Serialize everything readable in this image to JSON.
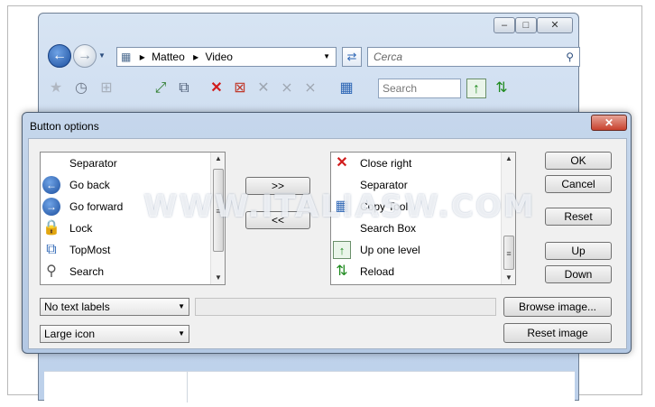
{
  "explorer": {
    "breadcrumb": [
      "Matteo",
      "Video"
    ],
    "search_placeholder": "Cerca",
    "toolbar_search_placeholder": "Search",
    "window_buttons": [
      "minimize",
      "maximize",
      "close"
    ]
  },
  "dialog": {
    "title": "Button options",
    "available_items": [
      {
        "label": "Separator",
        "icon": ""
      },
      {
        "label": "Go back",
        "icon": "back-arrow-icon"
      },
      {
        "label": "Go forward",
        "icon": "forward-arrow-icon"
      },
      {
        "label": "Lock",
        "icon": "lock-icon"
      },
      {
        "label": "TopMost",
        "icon": "topmost-icon"
      },
      {
        "label": "Search",
        "icon": "magnifier-icon"
      }
    ],
    "current_items": [
      {
        "label": "Close right",
        "icon": "close-right-icon"
      },
      {
        "label": "Separator",
        "icon": ""
      },
      {
        "label": "Copy Tool",
        "icon": "copy-tool-icon"
      },
      {
        "label": "Search Box",
        "icon": ""
      },
      {
        "label": "Up one level",
        "icon": "up-level-icon"
      },
      {
        "label": "Reload",
        "icon": "reload-icon"
      }
    ],
    "add_button": ">>",
    "remove_button": "<<",
    "ok_button": "OK",
    "cancel_button": "Cancel",
    "reset_button": "Reset",
    "up_button": "Up",
    "down_button": "Down",
    "browse_image_button": "Browse image...",
    "reset_image_button": "Reset image",
    "text_label_select": "No text labels",
    "icon_size_select": "Large icon"
  },
  "watermark": "WWW.ITALIASW.COM",
  "colors": {
    "dialog_frame": "#b3c8e3",
    "close_button": "#c8412d",
    "nav_button": "#2d66b5"
  }
}
